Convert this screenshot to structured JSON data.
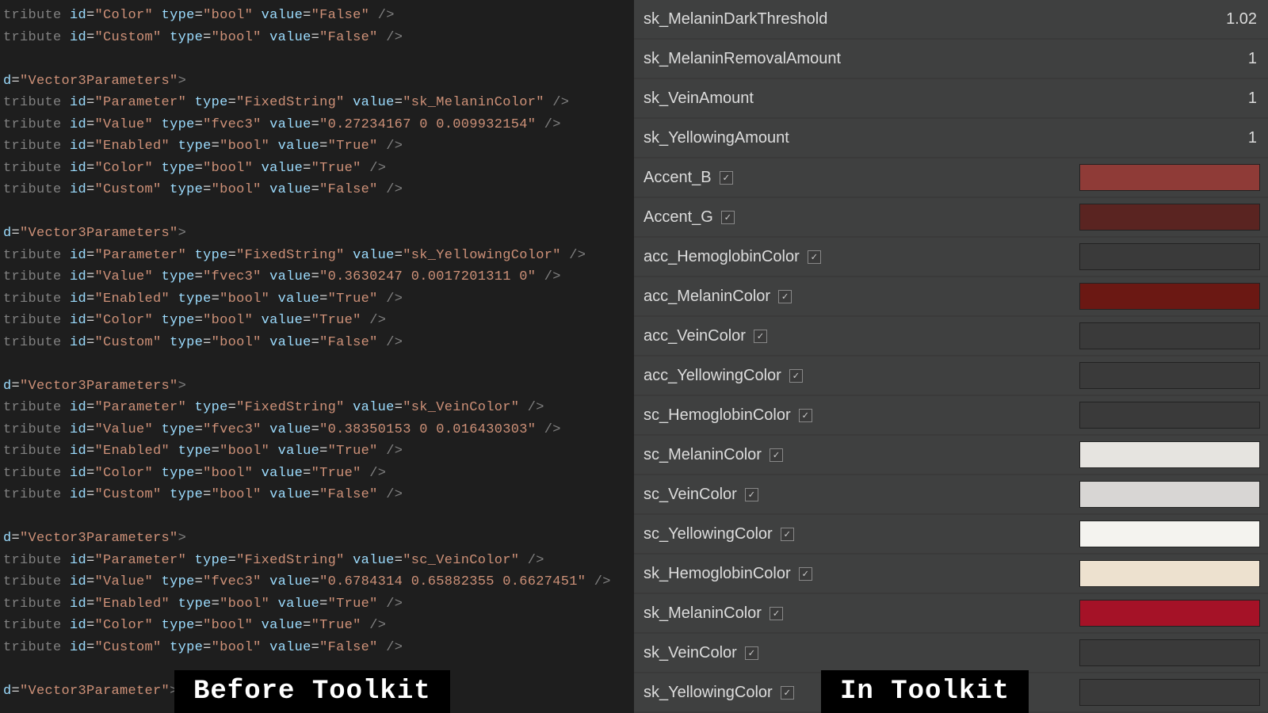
{
  "captions": {
    "left": "Before Toolkit",
    "right": "In Toolkit"
  },
  "code_blocks": [
    {
      "type": "attr",
      "id": "Color",
      "ttype": "bool",
      "value": "False"
    },
    {
      "type": "attr",
      "id": "Custom",
      "ttype": "bool",
      "value": "False"
    },
    {
      "type": "blank"
    },
    {
      "type": "node",
      "id": "Vector3Parameters"
    },
    {
      "type": "attr",
      "id": "Parameter",
      "ttype": "FixedString",
      "value": "sk_MelaninColor"
    },
    {
      "type": "attr",
      "id": "Value",
      "ttype": "fvec3",
      "value": "0.27234167 0 0.009932154"
    },
    {
      "type": "attr",
      "id": "Enabled",
      "ttype": "bool",
      "value": "True"
    },
    {
      "type": "attr",
      "id": "Color",
      "ttype": "bool",
      "value": "True"
    },
    {
      "type": "attr",
      "id": "Custom",
      "ttype": "bool",
      "value": "False"
    },
    {
      "type": "blank"
    },
    {
      "type": "node",
      "id": "Vector3Parameters"
    },
    {
      "type": "attr",
      "id": "Parameter",
      "ttype": "FixedString",
      "value": "sk_YellowingColor"
    },
    {
      "type": "attr",
      "id": "Value",
      "ttype": "fvec3",
      "value": "0.3630247 0.0017201311 0"
    },
    {
      "type": "attr",
      "id": "Enabled",
      "ttype": "bool",
      "value": "True"
    },
    {
      "type": "attr",
      "id": "Color",
      "ttype": "bool",
      "value": "True"
    },
    {
      "type": "attr",
      "id": "Custom",
      "ttype": "bool",
      "value": "False"
    },
    {
      "type": "blank"
    },
    {
      "type": "node",
      "id": "Vector3Parameters"
    },
    {
      "type": "attr",
      "id": "Parameter",
      "ttype": "FixedString",
      "value": "sk_VeinColor"
    },
    {
      "type": "attr",
      "id": "Value",
      "ttype": "fvec3",
      "value": "0.38350153 0 0.016430303"
    },
    {
      "type": "attr",
      "id": "Enabled",
      "ttype": "bool",
      "value": "True"
    },
    {
      "type": "attr",
      "id": "Color",
      "ttype": "bool",
      "value": "True"
    },
    {
      "type": "attr",
      "id": "Custom",
      "ttype": "bool",
      "value": "False"
    },
    {
      "type": "blank"
    },
    {
      "type": "node",
      "id": "Vector3Parameters"
    },
    {
      "type": "attr",
      "id": "Parameter",
      "ttype": "FixedString",
      "value": "sc_VeinColor"
    },
    {
      "type": "attr",
      "id": "Value",
      "ttype": "fvec3",
      "value": "0.6784314 0.65882355 0.6627451"
    },
    {
      "type": "attr",
      "id": "Enabled",
      "ttype": "bool",
      "value": "True"
    },
    {
      "type": "attr",
      "id": "Color",
      "ttype": "bool",
      "value": "True"
    },
    {
      "type": "attr",
      "id": "Custom",
      "ttype": "bool",
      "value": "False"
    },
    {
      "type": "blank"
    },
    {
      "type": "node",
      "id": "Vector3Parameter"
    }
  ],
  "properties": [
    {
      "kind": "num",
      "label": "sk_MelaninDarkThreshold",
      "value": "1.02"
    },
    {
      "kind": "num",
      "label": "sk_MelaninRemovalAmount",
      "value": "1"
    },
    {
      "kind": "num",
      "label": "sk_VeinAmount",
      "value": "1"
    },
    {
      "kind": "num",
      "label": "sk_YellowingAmount",
      "value": "1"
    },
    {
      "kind": "color",
      "label": "Accent_B",
      "checked": true,
      "swatch": "#8f3b37"
    },
    {
      "kind": "color",
      "label": "Accent_G",
      "checked": true,
      "swatch": "#5a2421"
    },
    {
      "kind": "color",
      "label": "acc_HemoglobinColor",
      "checked": true,
      "swatch": "#3a3a3a"
    },
    {
      "kind": "color",
      "label": "acc_MelaninColor",
      "checked": true,
      "swatch": "#6b1813"
    },
    {
      "kind": "color",
      "label": "acc_VeinColor",
      "checked": true,
      "swatch": "#3a3a3a"
    },
    {
      "kind": "color",
      "label": "acc_YellowingColor",
      "checked": true,
      "swatch": "#3a3a3a"
    },
    {
      "kind": "color",
      "label": "sc_HemoglobinColor",
      "checked": true,
      "swatch": "#3a3a3a"
    },
    {
      "kind": "color",
      "label": "sc_MelaninColor",
      "checked": true,
      "swatch": "#e6e4e0"
    },
    {
      "kind": "color",
      "label": "sc_VeinColor",
      "checked": true,
      "swatch": "#d8d6d4"
    },
    {
      "kind": "color",
      "label": "sc_YellowingColor",
      "checked": true,
      "swatch": "#f4f3ef"
    },
    {
      "kind": "color",
      "label": "sk_HemoglobinColor",
      "checked": true,
      "swatch": "#ede1cf"
    },
    {
      "kind": "color",
      "label": "sk_MelaninColor",
      "checked": true,
      "swatch": "#a51227"
    },
    {
      "kind": "color",
      "label": "sk_VeinColor",
      "checked": true,
      "swatch": "#3a3a3a"
    },
    {
      "kind": "color",
      "label": "sk_YellowingColor",
      "checked": true,
      "swatch": "#3a3a3a"
    }
  ]
}
